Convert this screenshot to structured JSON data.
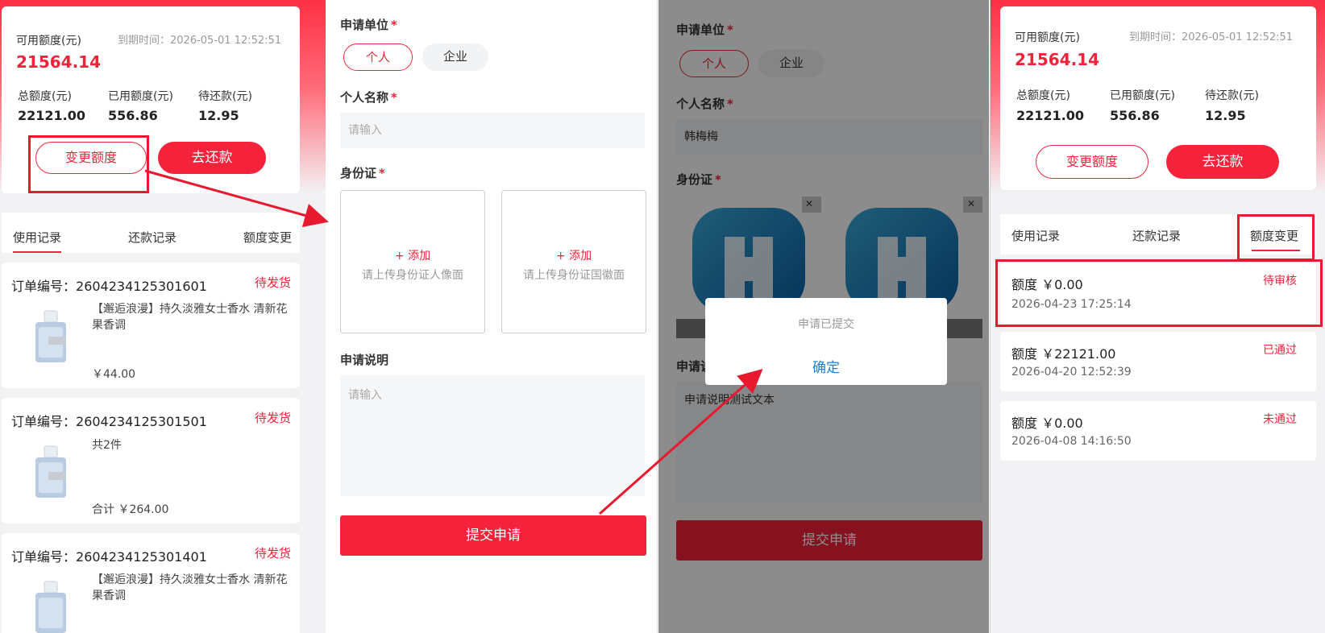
{
  "colors": {
    "brand_red": "#f0233a",
    "dark_red": "#7d0c1a",
    "link_blue": "#1a7fd6"
  },
  "summary": {
    "available_label": "可用额度(元)",
    "available_value": "21564.14",
    "expiry": "到期时间：2026-05-01 12:52:51",
    "total_label": "总额度(元)",
    "total_value": "22121.00",
    "used_label": "已用额度(元)",
    "used_value": "556.86",
    "pending_label": "待还款(元)",
    "pending_value": "12.95",
    "change_button": "变更额度",
    "repay_button": "去还款"
  },
  "tabs": {
    "usage": "使用记录",
    "repay": "还款记录",
    "change": "额度变更"
  },
  "orders": [
    {
      "no_label": "订单编号：",
      "no": "2604234125301601",
      "status": "待发货",
      "title": "【邂逅浪漫】持久淡雅女士香水 清新花果香调",
      "price": "￥44.00"
    },
    {
      "no_label": "订单编号：",
      "no": "2604234125301501",
      "status": "待发货",
      "title": "共2件",
      "price": "合计 ￥264.00"
    },
    {
      "no_label": "订单编号：",
      "no": "2604234125301401",
      "status": "待发货",
      "title": "【邂逅浪漫】持久淡雅女士香水 清新花果香调",
      "price": ""
    }
  ],
  "icons": {
    "perfume": "perfume-bottle-icon",
    "logo": "app-logo-image",
    "close": "close-icon"
  },
  "form": {
    "unit_label": "申请单位",
    "star": "*",
    "option_personal": "个人",
    "option_company": "企业",
    "name_label": "个人名称",
    "name_placeholder": "请输入",
    "name_filled": "韩梅梅",
    "id_label": "身份证",
    "add_text": "+ 添加",
    "upload_front": "请上传身份证人像面",
    "upload_back": "请上传身份证国徽面",
    "desc_label": "申请说明",
    "desc_placeholder": "请输入",
    "desc_filled": "申请说明测试文本",
    "desc_label_partial": "申请说",
    "submit": "提交申请"
  },
  "dialog": {
    "message": "申请已提交",
    "confirm": "确定"
  },
  "changes": [
    {
      "amount": "额度 ￥0.00",
      "date": "2026-04-23 17:25:14",
      "status": "待审核"
    },
    {
      "amount": "额度 ￥22121.00",
      "date": "2026-04-20 12:52:39",
      "status": "已通过"
    },
    {
      "amount": "额度 ￥0.00",
      "date": "2026-04-08 14:16:50",
      "status": "未通过"
    }
  ]
}
